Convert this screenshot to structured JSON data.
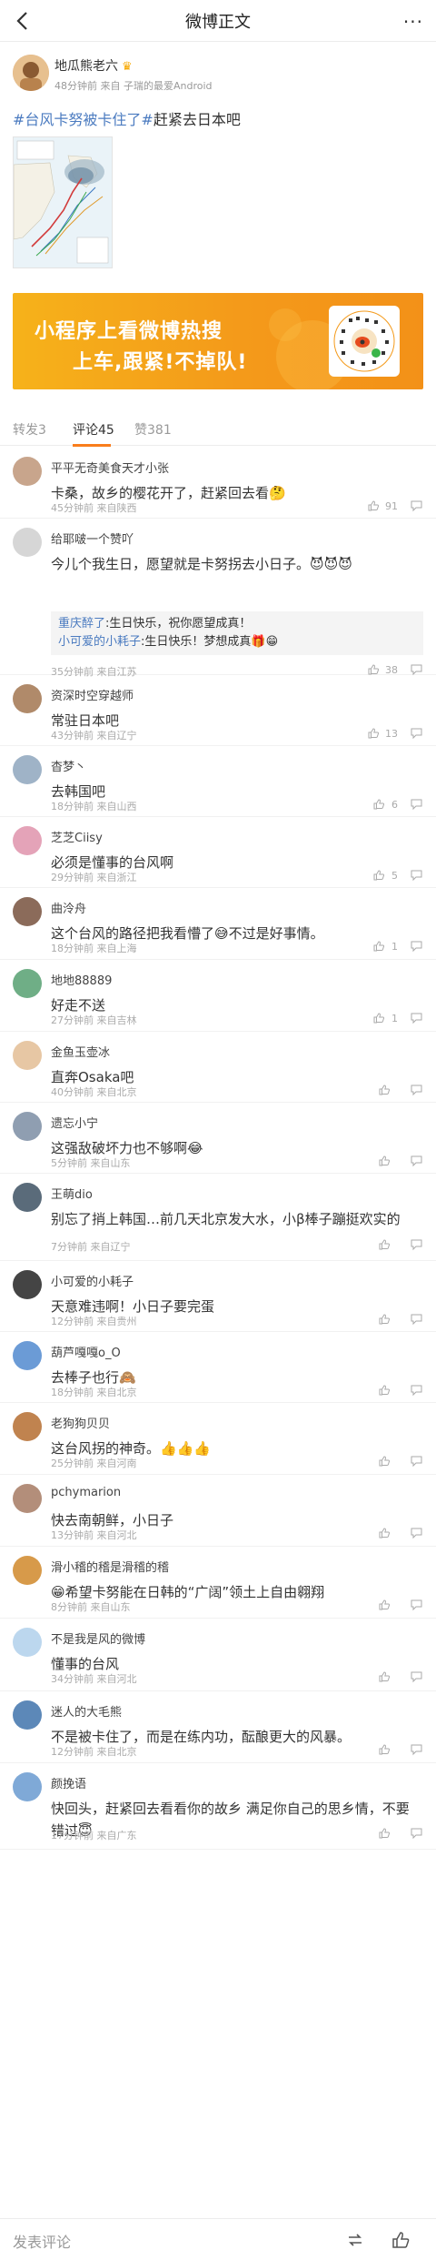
{
  "nav": {
    "title": "微博正文",
    "more": "···"
  },
  "post": {
    "author": "地瓜熊老六",
    "meta": "48分钟前 来自 子瑞的最爱Android",
    "hashtag": "#台风卡努被卡住了#",
    "text": "赶紧去日本吧"
  },
  "banner": {
    "line1": "小程序上看微博热搜",
    "line2": "上车,跟紧!不掉队!"
  },
  "tabs": [
    {
      "label": "转发3"
    },
    {
      "label": "评论45"
    },
    {
      "label": "赞381"
    }
  ],
  "comments": [
    {
      "name": "平平无奇美食天才小张",
      "text": "卡桑，故乡的樱花开了，赶紧回去看🤔",
      "meta": "45分钟前 来自陕西",
      "likes": "91"
    },
    {
      "name": "给耶啵一个赞吖",
      "text": "今儿个我生日，愿望就是卡努拐去小日子。😈😈😈",
      "meta": "35分钟前 来自江苏",
      "likes": "38"
    },
    {
      "name": "资深时空穿越师",
      "text": "常驻日本吧",
      "meta": "43分钟前 来自辽宁",
      "likes": "13"
    },
    {
      "name": "杳梦丶",
      "text": "去韩国吧",
      "meta": "18分钟前 来自山西",
      "likes": "6"
    },
    {
      "name": "芝芝Ciisy",
      "text": "必须是懂事的台风啊",
      "meta": "29分钟前 来自浙江",
      "likes": "5"
    },
    {
      "name": "曲泠舟",
      "text": "这个台风的路径把我看懵了😅不过是好事情。",
      "meta": "18分钟前 来自上海",
      "likes": "1"
    },
    {
      "name": "地地88889",
      "text": "好走不送",
      "meta": "27分钟前 来自吉林",
      "likes": "1"
    },
    {
      "name": "金鱼玉壶冰",
      "text": "直奔Osaka吧",
      "meta": "40分钟前 来自北京",
      "likes": ""
    },
    {
      "name": "遗忘小宁",
      "text": "这强敌破坏力也不够啊😂",
      "meta": "5分钟前 来自山东",
      "likes": ""
    },
    {
      "name": "王萌dio",
      "text": "别忘了捎上韩国…前几天北京发大水，小β棒子蹦挺欢实的",
      "meta": "7分钟前 来自辽宁",
      "likes": ""
    },
    {
      "name": "小可爱的小耗子",
      "text": "天意难违啊！小日子要完蛋",
      "meta": "12分钟前 来自贵州",
      "likes": ""
    },
    {
      "name": "葫芦嘎嘎o_O",
      "text": "去棒子也行🙈",
      "meta": "18分钟前 来自北京",
      "likes": ""
    },
    {
      "name": "老狗狗贝贝",
      "text": "这台风拐的神奇。👍👍👍",
      "meta": "25分钟前 来自河南",
      "likes": ""
    },
    {
      "name": "pchymarion",
      "text": "快去南朝鲜，小日子",
      "meta": "13分钟前 来自河北",
      "likes": ""
    },
    {
      "name": "滑小稽的稽是滑稽的稽",
      "text": "😁希望卡努能在日韩的“广阔”领土上自由翱翔",
      "meta": "8分钟前 来自山东",
      "likes": ""
    },
    {
      "name": "不是我是风的微博",
      "text": "懂事的台风",
      "meta": "34分钟前 来自河北",
      "likes": ""
    },
    {
      "name": "迷人的大毛熊",
      "text": "不是被卡住了，而是在练内功，酝酿更大的风暴。",
      "meta": "12分钟前 来自北京",
      "likes": ""
    },
    {
      "name": "颜挽语",
      "text": "快回头，赶紧回去看看你的故乡 满足你自己的思乡情，不要错过😇",
      "meta": "17分钟前 来自广东",
      "likes": ""
    }
  ],
  "replies": [
    {
      "name": "重庆醉了",
      "text": ":生日快乐，祝你愿望成真！"
    },
    {
      "name": "小可爱的小耗子",
      "text": ":生日快乐！梦想成真🎁😁"
    }
  ],
  "bottom": {
    "placeholder": "发表评论"
  },
  "colors": {
    "accent": "#f97d1c",
    "link": "#4b7bc0",
    "meta": "#aaaaaa"
  }
}
